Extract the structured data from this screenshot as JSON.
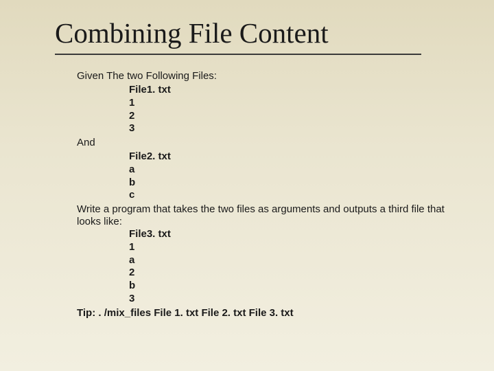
{
  "title": "Combining File Content",
  "intro": "Given The two Following Files:",
  "file1": {
    "name": "File1. txt",
    "lines": [
      "1",
      "2",
      "3"
    ]
  },
  "and": "And",
  "file2": {
    "name": "File2. txt",
    "lines": [
      "a",
      "b",
      "c"
    ]
  },
  "task": "Write a program that takes the two files as arguments and outputs a third file that looks like:",
  "file3": {
    "name": "File3. txt",
    "lines": [
      "1",
      "a",
      "2",
      "b",
      "3"
    ]
  },
  "tip": "Tip: . /mix_files File 1. txt File 2. txt File 3. txt"
}
